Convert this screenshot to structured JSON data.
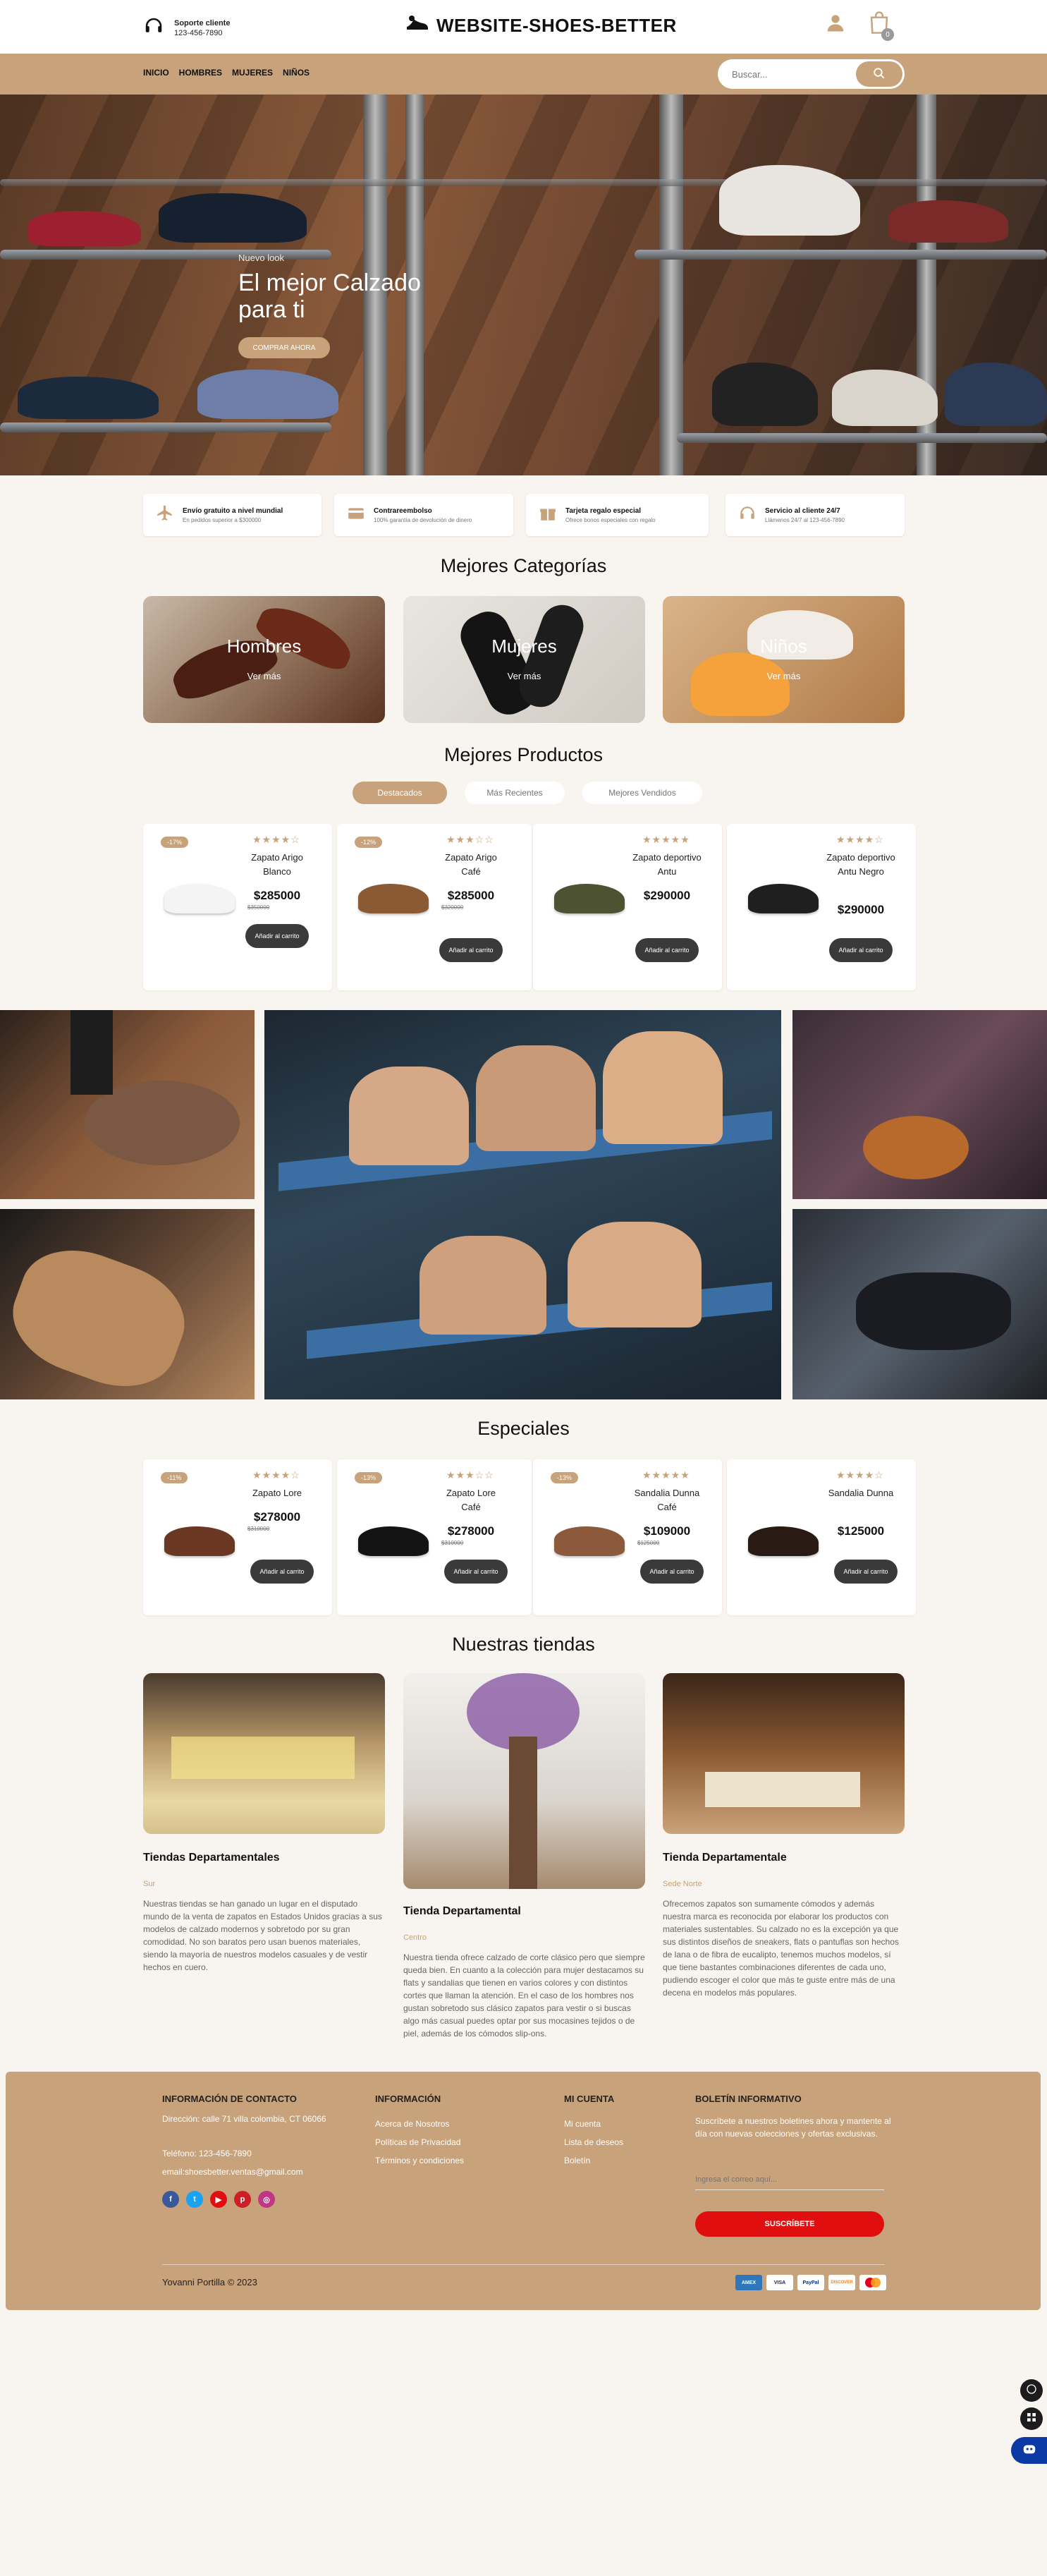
{
  "header": {
    "support_line1": "Soporte cliente",
    "support_line2": "123-456-7890",
    "logo": "WEBSITE-SHOES-BETTER",
    "cart_count": "0"
  },
  "nav": {
    "links": [
      "INICIO",
      "HOMBRES",
      "MUJERES",
      "NIÑOS"
    ],
    "search_placeholder": "Buscar..."
  },
  "hero": {
    "small": "Nuevo look",
    "title": "El mejor Calzado para ti",
    "button": "COMPRAR AHORA"
  },
  "features": [
    {
      "title": "Envío gratuito a nivel mundial",
      "sub": "En pedidos superior a $300000"
    },
    {
      "title": "Contrareembolso",
      "sub": "100% garantía de devolución de dinero"
    },
    {
      "title": "Tarjeta regalo especial",
      "sub": "Ofrece bonos especiales con regalo"
    },
    {
      "title": "Servicio al cliente 24/7",
      "sub": "Llámenos 24/7 al 123-456-7890"
    }
  ],
  "categories": {
    "title": "Mejores Categorías",
    "items": [
      {
        "name": "Hombres",
        "link": "Ver más"
      },
      {
        "name": "Mujeres",
        "link": "Ver más"
      },
      {
        "name": "Niños",
        "link": "Ver más"
      }
    ]
  },
  "products": {
    "title": "Mejores Productos",
    "tabs": [
      "Destacados",
      "Más Recientes",
      "Mejores Vendidos"
    ],
    "items": [
      {
        "discount": "-17%",
        "name": "Zapato Arigo Blanco",
        "price": "$285000",
        "old": "$350000",
        "button": "Añadir al carrito",
        "rating": 4
      },
      {
        "discount": "-12%",
        "name": "Zapato Arigo Café",
        "price": "$285000",
        "old": "$320000",
        "button": "Añadir al carrito",
        "rating": 3
      },
      {
        "discount": "",
        "name": "Zapato deportivo Antu",
        "price": "$290000",
        "old": "",
        "button": "Añadir al carrito",
        "rating": 5
      },
      {
        "discount": "",
        "name": "Zapato deportivo Antu Negro",
        "price": "$290000",
        "old": "",
        "button": "Añadir al carrito",
        "rating": 4
      }
    ]
  },
  "specials": {
    "title": "Especiales",
    "items": [
      {
        "discount": "-11%",
        "name": "Zapato Lore",
        "price": "$278000",
        "old": "$310000",
        "button": "Añadir al carrito",
        "rating": 4
      },
      {
        "discount": "-13%",
        "name": "Zapato Lore Café",
        "price": "$278000",
        "old": "$310000",
        "button": "Añadir al carrito",
        "rating": 3
      },
      {
        "discount": "-13%",
        "name": "Sandalia Dunna Café",
        "price": "$109000",
        "old": "$125000",
        "button": "Añadir al carrito",
        "rating": 5
      },
      {
        "discount": "",
        "name": "Sandalia Dunna",
        "price": "$125000",
        "old": "",
        "button": "Añadir al carrito",
        "rating": 4
      }
    ]
  },
  "stores": {
    "title": "Nuestras tiendas",
    "items": [
      {
        "name": "Tiendas Departamentales",
        "region": "Sur",
        "desc": "Nuestras tiendas se han ganado un lugar en el disputado mundo de la venta de zapatos en Estados Unidos gracias a sus modelos de calzado modernos y sobretodo por su gran comodidad. No son baratos pero usan buenos materiales, siendo la mayoría de nuestros modelos casuales y de vestir hechos en cuero."
      },
      {
        "name": "Tienda Departamental",
        "region": "Centro",
        "desc": "Nuestra tienda ofrece calzado de corte clásico pero que siempre queda bien. En cuanto a la colección para mujer destacamos su flats y sandalias que tienen en varios colores y con distintos cortes que llaman la atención. En el caso de los hombres nos gustan sobretodo sus clásico zapatos para vestir o si buscas algo más casual puedes optar por sus mocasines tejidos o de piel, además de los cómodos slip-ons."
      },
      {
        "name": "Tienda Departamentale",
        "region": "Sede Norte",
        "desc": "Ofrecemos zapatos son sumamente cómodos y además nuestra marca es reconocida por elaborar los productos con materiales sustentables. Su calzado no es la excepción ya que sus distintos diseños de sneakers, flats o pantuflas son hechos de lana o de fibra de eucalipto, tenemos muchos modelos, sí que tiene bastantes combinaciones diferentes de cada uno, pudiendo escoger el color que más te guste entre más de una decena en modelos más populares."
      }
    ]
  },
  "footer": {
    "contact": {
      "title": "INFORMACIÓN DE CONTACTO",
      "address": "Dirección: calle 71 villa colombia, CT 06066",
      "phone": "Teléfono: 123-456-7890",
      "email": "email:shoesbetter.ventas@gmail.com"
    },
    "info": {
      "title": "INFORMACIÓN",
      "links": [
        "Acerca de Nosotros",
        "Políticas de Privacidad",
        "Términos y condiciones"
      ]
    },
    "account": {
      "title": "MI CUENTA",
      "links": [
        "Mi cuenta",
        "Lista de deseos",
        "Boletín"
      ]
    },
    "newsletter": {
      "title": "BOLETÍN INFORMATIVO",
      "text": "Suscríbete a nuestros boletines ahora y mantente al día con nuevas colecciones y ofertas exclusivas.",
      "placeholder": "Ingresa el correo aquí...",
      "button": "SUSCRÍBETE"
    },
    "copyright": "Yovanni Portilla © 2023",
    "payments": [
      "AMEX",
      "VISA",
      "PayPal",
      "DISCOVER",
      "MC"
    ]
  },
  "colors": {
    "accent": "#c7a27a",
    "dark": "#3a3a3a",
    "red": "#e00e0e",
    "bg": "#f8f4ef"
  }
}
